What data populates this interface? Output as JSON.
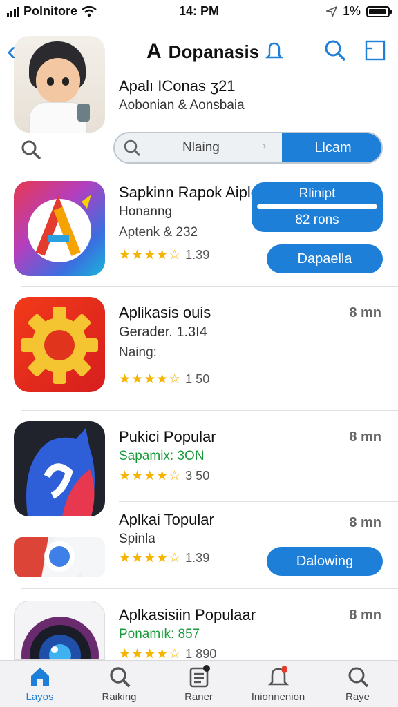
{
  "status": {
    "carrier": "Polnitore",
    "time": "14: PM",
    "battery": "1%"
  },
  "header": {
    "title": "Dopanasis",
    "app_title": "Apalı IConas ʒ21",
    "app_subtitle": "Aobonian & Aonsbaia"
  },
  "segmented": {
    "left_label": "Nlaing",
    "right_label": "Llcam"
  },
  "apps": [
    {
      "name": "Sapkinn Rapok Aiplog:",
      "line2": "Honanng",
      "line3": "Aptenk & 232",
      "stars": "★★★★☆",
      "rating": "1.39",
      "panel_top": "Rlinipt",
      "panel_bottom": "82 rons",
      "button": "Dapaella"
    },
    {
      "name": "Aplikasis ouis",
      "line2": "Gerader. 1.3I4",
      "line3": "Naing:",
      "stars": "★★★★☆",
      "rating": "1 50",
      "size": "8 mn"
    },
    {
      "name": "Pukici Popular",
      "line2": "Sapamix: 3ON",
      "stars": "★★★★☆",
      "rating": "3 50",
      "size": "8 mn"
    },
    {
      "name": "Aplkai Topular",
      "line2": "Spinla",
      "stars": "★★★★☆",
      "rating": "1.39",
      "size": "8 mn",
      "button": "Dalowing"
    },
    {
      "name": "Aplkasisiin Populaar",
      "line2": "Ponamık: 857",
      "stars": "★★★★☆",
      "rating": "1 890",
      "size": "8 mn"
    }
  ],
  "tabs": [
    {
      "label": "Layos",
      "icon": "home-icon"
    },
    {
      "label": "Raiking",
      "icon": "search-icon"
    },
    {
      "label": "Raner",
      "icon": "list-icon"
    },
    {
      "label": "Inionnenion",
      "icon": "notification-icon"
    },
    {
      "label": "Raye",
      "icon": "search-icon"
    }
  ],
  "colors": {
    "accent": "#1e7fd8",
    "star": "#f4b400",
    "green_text": "#1a9a3a"
  }
}
